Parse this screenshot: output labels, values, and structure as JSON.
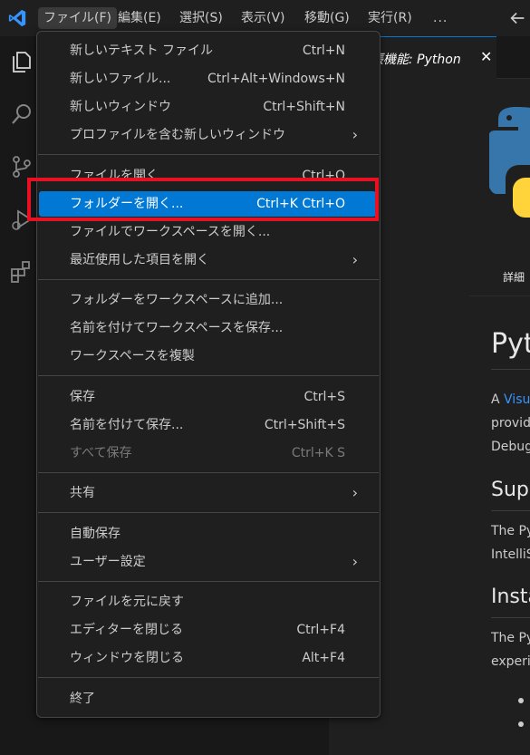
{
  "menubar": {
    "items": [
      "ファイル(F)",
      "編集(E)",
      "選択(S)",
      "表示(V)",
      "移動(G)",
      "実行(R)",
      "..."
    ]
  },
  "tab": {
    "label": "張機能: Python",
    "close": "✕"
  },
  "editor": {
    "details_tab": "詳細",
    "heading": "Pyt",
    "para1_a": "A ",
    "para1_link": "Visu",
    "para1_line2": "provid",
    "para1_line3": "Debug",
    "h2_support": "Supp",
    "para2_line1": "The Py",
    "para2_line2": "IntelliS",
    "h2_install": "Insta",
    "para3_line1": "The Py",
    "para3_line2": "experie"
  },
  "file_menu": {
    "items": [
      {
        "label": "新しいテキスト ファイル",
        "shortcut": "Ctrl+N"
      },
      {
        "label": "新しいファイル...",
        "shortcut": "Ctrl+Alt+Windows+N"
      },
      {
        "label": "新しいウィンドウ",
        "shortcut": "Ctrl+Shift+N"
      },
      {
        "label": "プロファイルを含む新しいウィンドウ",
        "submenu": true
      },
      {
        "label": "ファイルを開く...",
        "shortcut": "Ctrl+O"
      },
      {
        "label": "フォルダーを開く...",
        "shortcut": "Ctrl+K Ctrl+O",
        "highlighted": true
      },
      {
        "label": "ファイルでワークスペースを開く..."
      },
      {
        "label": "最近使用した項目を開く",
        "submenu": true
      },
      {
        "label": "フォルダーをワークスペースに追加..."
      },
      {
        "label": "名前を付けてワークスペースを保存..."
      },
      {
        "label": "ワークスペースを複製"
      },
      {
        "label": "保存",
        "shortcut": "Ctrl+S"
      },
      {
        "label": "名前を付けて保存...",
        "shortcut": "Ctrl+Shift+S"
      },
      {
        "label": "すべて保存",
        "shortcut": "Ctrl+K S",
        "disabled": true
      },
      {
        "label": "共有",
        "submenu": true
      },
      {
        "label": "自動保存"
      },
      {
        "label": "ユーザー設定",
        "submenu": true
      },
      {
        "label": "ファイルを元に戻す"
      },
      {
        "label": "エディターを閉じる",
        "shortcut": "Ctrl+F4"
      },
      {
        "label": "ウィンドウを閉じる",
        "shortcut": "Alt+F4"
      },
      {
        "label": "終了"
      }
    ]
  },
  "colors": {
    "accent": "#0078d4",
    "highlight_box": "#e81123",
    "link": "#3794ff"
  },
  "icons": [
    "vscode-logo-icon",
    "explorer-icon",
    "search-icon",
    "source-control-icon",
    "run-debug-icon",
    "extensions-icon",
    "back-arrow-icon",
    "python-logo-icon",
    "chevron-right-icon"
  ]
}
